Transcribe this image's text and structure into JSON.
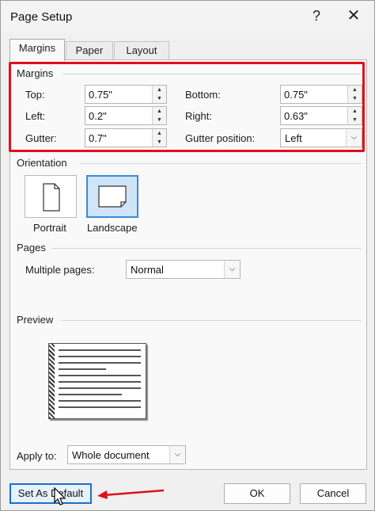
{
  "window": {
    "title": "Page Setup",
    "help": "?",
    "close": "✕"
  },
  "tabs": [
    {
      "label": "Margins",
      "active": true
    },
    {
      "label": "Paper",
      "active": false
    },
    {
      "label": "Layout",
      "active": false
    }
  ],
  "margins": {
    "section": "Margins",
    "top": {
      "label": "Top:",
      "value": "0.75\""
    },
    "bottom": {
      "label": "Bottom:",
      "value": "0.75\""
    },
    "left": {
      "label": "Left:",
      "value": "0.2\""
    },
    "right": {
      "label": "Right:",
      "value": "0.63\""
    },
    "gutter": {
      "label": "Gutter:",
      "value": "0.7\""
    },
    "gutter_position": {
      "label": "Gutter position:",
      "value": "Left"
    }
  },
  "orientation": {
    "section": "Orientation",
    "portrait": "Portrait",
    "landscape": "Landscape",
    "selected": "landscape"
  },
  "pages": {
    "section": "Pages",
    "multiple_label": "Multiple pages:",
    "multiple_value": "Normal"
  },
  "preview": {
    "section": "Preview"
  },
  "apply": {
    "label": "Apply to:",
    "value": "Whole document"
  },
  "buttons": {
    "set_default": "Set As Default",
    "ok": "OK",
    "cancel": "Cancel"
  },
  "colors": {
    "highlight": "#e0101a",
    "accent": "#1e6fc4",
    "selected_bg": "#cfe4f7"
  }
}
